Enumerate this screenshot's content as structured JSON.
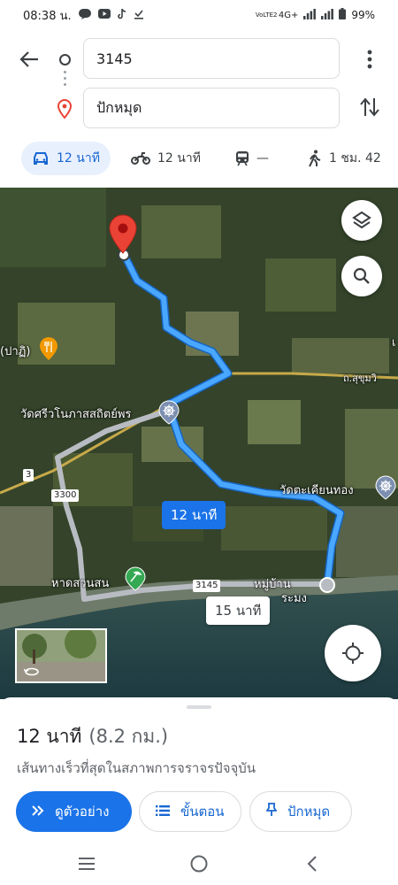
{
  "status_bar": {
    "time": "08:38 น.",
    "network": "4G+",
    "volte": "VoLTE2",
    "battery": "99%"
  },
  "directions": {
    "origin_value": "3145",
    "destination_value": "ปักหมุด"
  },
  "modes": [
    {
      "icon": "car-icon",
      "label": "12 นาที",
      "active": true
    },
    {
      "icon": "motorcycle-icon",
      "label": "12 นาที",
      "active": false
    },
    {
      "icon": "train-icon",
      "label": "—",
      "active": false
    },
    {
      "icon": "walk-icon",
      "label": "1 ชม. 42",
      "active": false
    }
  ],
  "map": {
    "labels": {
      "restaurant": "(ปาฏิ)",
      "road_sukhumvit": "ถ.สุขุมวิ",
      "temple_1": "วัดศรีวโนภาสสถิตย์พร",
      "temple_2": "วัดตะเคียนทอง",
      "beach": "หาดสวนสน",
      "village": "หมู่บ้าน",
      "village_2": "ระมง",
      "edge_letter": "เ"
    },
    "shields": {
      "route_3": "3",
      "route_3300": "3300",
      "route_3145": "3145"
    },
    "primary_duration": "12 นาที",
    "alt_duration": "15 นาที"
  },
  "sheet": {
    "duration": "12 นาที",
    "distance": "(8.2 กม.)",
    "subtitle": "เส้นทางเร็วที่สุดในสภาพการจราจรปัจจุบัน",
    "preview_label": "ดูตัวอย่าง",
    "steps_label": "ขั้นตอน",
    "pin_label": "ปักหมุด"
  },
  "colors": {
    "accent": "#1a73e8",
    "route": "#4aa7ff",
    "alt_route": "#b8bcc2",
    "pin": "#ea4335"
  }
}
